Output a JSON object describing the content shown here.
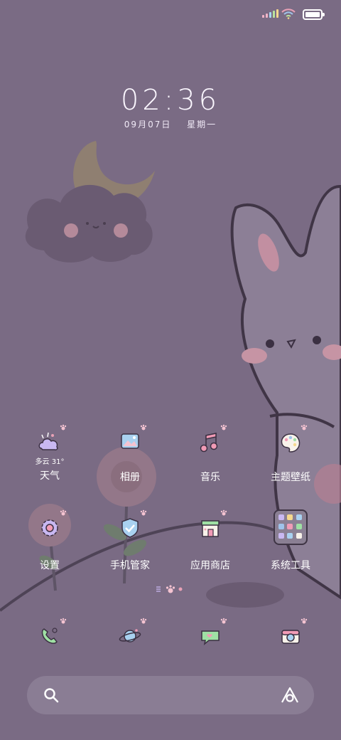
{
  "status_bar": {
    "battery_level": 1.0
  },
  "lock": {
    "time": "02:36",
    "date": "09月07日",
    "weekday": "星期一"
  },
  "home": {
    "row1": [
      {
        "icon": "weather-icon",
        "sublabel": "多云 31°",
        "label": "天气"
      },
      {
        "icon": "gallery-icon",
        "label": "相册"
      },
      {
        "icon": "music-icon",
        "label": "音乐"
      },
      {
        "icon": "theme-palette-icon",
        "label": "主题壁纸"
      }
    ],
    "row2": [
      {
        "icon": "settings-gear-icon",
        "label": "设置"
      },
      {
        "icon": "shield-check-icon",
        "label": "手机管家"
      },
      {
        "icon": "app-store-icon",
        "label": "应用商店"
      },
      {
        "icon": "folder-icon",
        "label": "系统工具"
      }
    ]
  },
  "dock": [
    {
      "icon": "phone-icon"
    },
    {
      "icon": "planet-browser-icon"
    },
    {
      "icon": "message-bubble-icon"
    },
    {
      "icon": "camera-icon"
    }
  ],
  "colors": {
    "background": "#7a6b84",
    "accent_pink": "#e9a1b6",
    "accent_blue": "#9fc3ea",
    "accent_green": "#9fe0a4"
  }
}
